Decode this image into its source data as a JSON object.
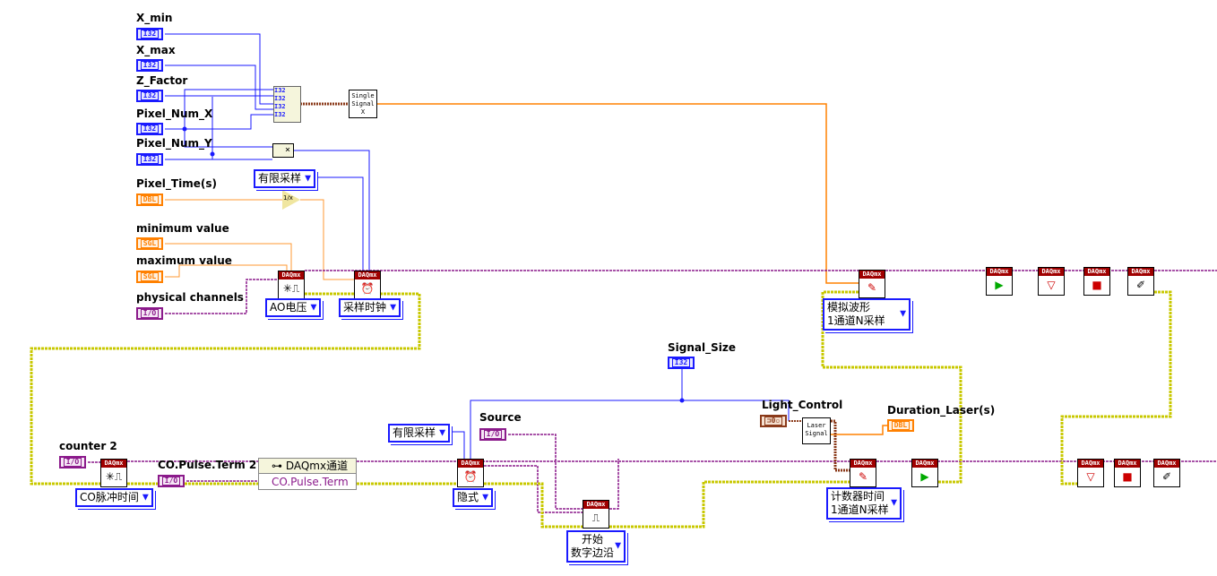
{
  "controls": {
    "x_min": {
      "label": "X_min",
      "type": "I32"
    },
    "x_max": {
      "label": "X_max",
      "type": "I32"
    },
    "z_factor": {
      "label": "Z_Factor",
      "type": "I32"
    },
    "pixel_num_x": {
      "label": "Pixel_Num_X",
      "type": "I32"
    },
    "pixel_num_y": {
      "label": "Pixel_Num_Y",
      "type": "I32"
    },
    "pixel_time": {
      "label": "Pixel_Time(s)",
      "type": "DBL"
    },
    "minimum_value": {
      "label": "minimum value",
      "type": "SGL"
    },
    "maximum_value": {
      "label": "maximum value",
      "type": "SGL"
    },
    "physical_channels": {
      "label": "physical channels",
      "type": "I/O"
    },
    "signal_size": {
      "label": "Signal_Size",
      "type": "I32"
    },
    "source": {
      "label": "Source",
      "type": "I/O"
    },
    "light_control": {
      "label": "Light_Control",
      "type": "⊐0▫"
    },
    "duration_laser": {
      "label": "Duration_Laser(s)",
      "type": "DBL"
    },
    "counter2": {
      "label": "counter 2",
      "type": "I/O"
    },
    "co_pulse_term2": {
      "label": "CO.Pulse.Term 2",
      "type": "I/O"
    }
  },
  "build_array": {
    "inputs": [
      "I32",
      "I32",
      "I32",
      "I32",
      "I32"
    ]
  },
  "subvis": {
    "single_signal": "Single Signal X",
    "laser_signal": "Laser Signal",
    "multiply": "×",
    "reciprocal": "1/x"
  },
  "daqmx_header": "DAQmx",
  "enums": {
    "sample_mode_ao": "有限采样",
    "ao_voltage": "AO电压",
    "sample_clock": "采样时钟",
    "analog_write_line1": "模拟波形",
    "analog_write_line2": "1通道N采样",
    "co_pulse_time": "CO脉冲时间",
    "sample_mode_co": "有限采样",
    "implicit": "隐式",
    "trigger_line1": "开始",
    "trigger_line2": "数字边沿",
    "counter_write_line1": "计数器时间",
    "counter_write_line2": "1通道N采样"
  },
  "property_node": {
    "title": "DAQmx通道",
    "property": "CO.Pulse.Term"
  },
  "colors": {
    "int_wire": "#1a1aff",
    "dbl_wire": "#ff8000",
    "task_wire": "#8b1a8b",
    "error_wire": "#c8c800",
    "waveform_wire": "#8b3a1a"
  }
}
